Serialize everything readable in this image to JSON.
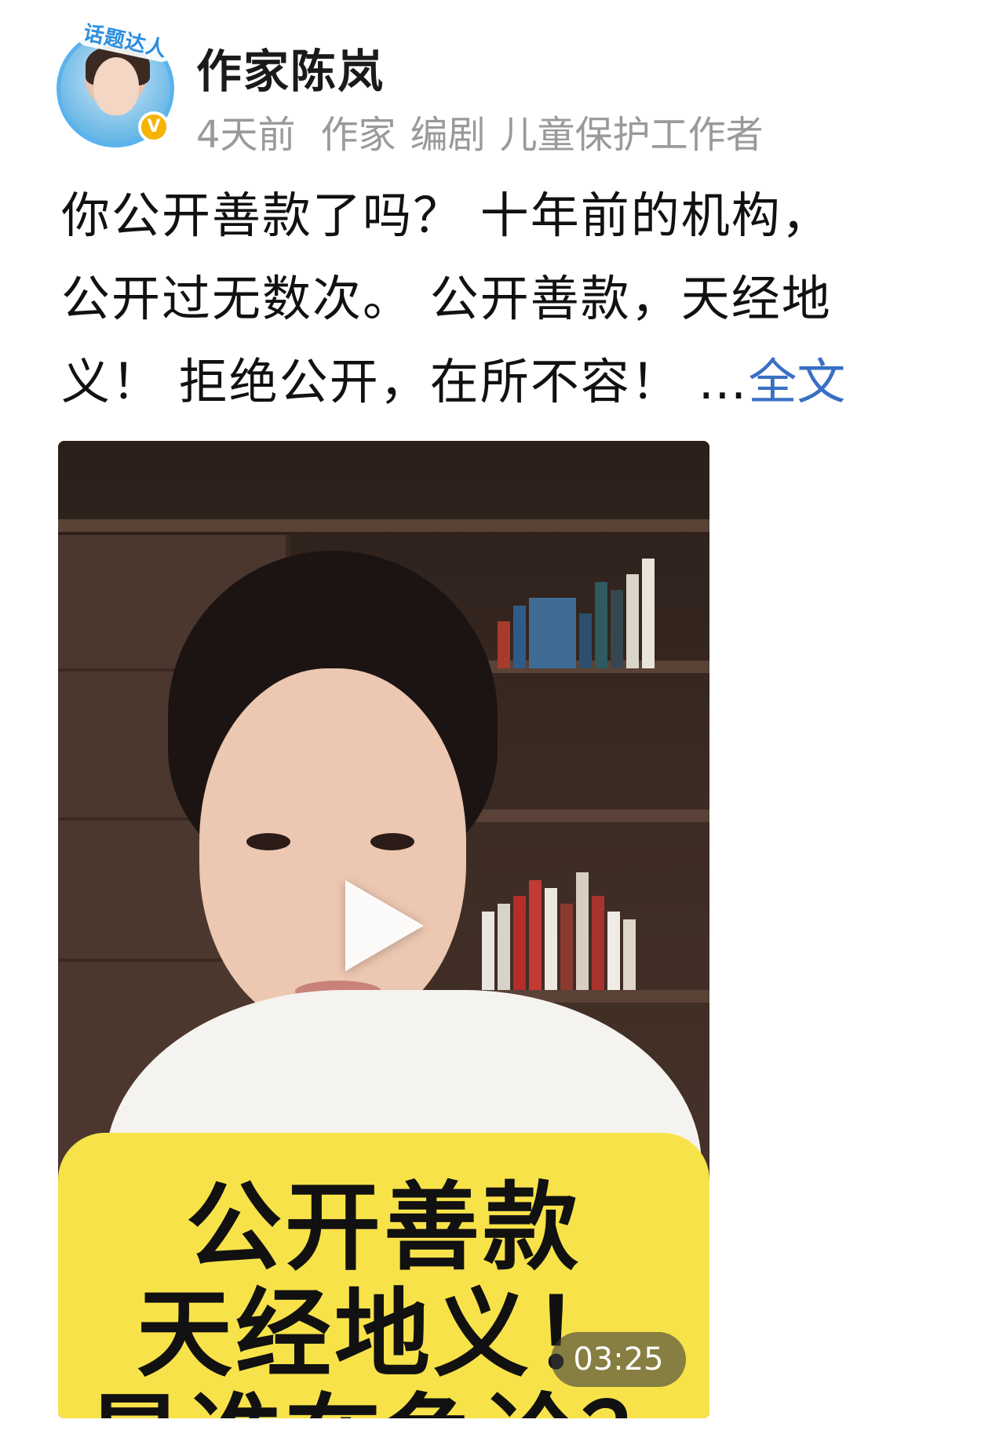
{
  "post": {
    "author": {
      "name": "作家陈岚",
      "avatar_badge": "话题达人",
      "verified_mark": "V"
    },
    "meta": {
      "time": "4天前",
      "tags": [
        "作家",
        "编剧",
        "儿童保护工作者"
      ]
    },
    "text_lines": [
      "你公开善款了吗？ 十年前的机构，",
      "公开过无数次。 公开善款，天经地",
      "义！ 拒绝公开，在所不容！ …"
    ],
    "more_label": "全文",
    "video": {
      "duration": "03:25",
      "caption_lines": [
        "公开善款",
        "天经地义！",
        "是谁在争论？"
      ]
    }
  }
}
